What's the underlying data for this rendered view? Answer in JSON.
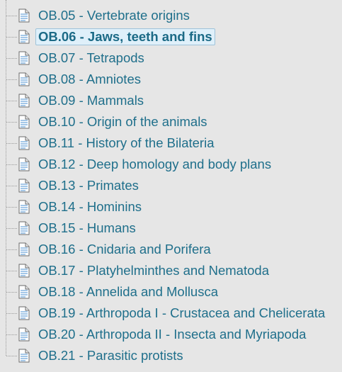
{
  "tree": {
    "items": [
      {
        "label": "OB.05 - Vertebrate origins",
        "selected": false
      },
      {
        "label": "OB.06 - Jaws, teeth and fins",
        "selected": true
      },
      {
        "label": "OB.07 - Tetrapods",
        "selected": false
      },
      {
        "label": "OB.08 - Amniotes",
        "selected": false
      },
      {
        "label": "OB.09 - Mammals",
        "selected": false
      },
      {
        "label": "OB.10 - Origin of the animals",
        "selected": false
      },
      {
        "label": "OB.11 - History of the Bilateria",
        "selected": false
      },
      {
        "label": "OB.12 - Deep homology and body plans",
        "selected": false
      },
      {
        "label": "OB.13 - Primates",
        "selected": false
      },
      {
        "label": "OB.14 - Hominins",
        "selected": false
      },
      {
        "label": "OB.15 - Humans",
        "selected": false
      },
      {
        "label": "OB.16 - Cnidaria and Porifera",
        "selected": false
      },
      {
        "label": "OB.17 - Platyhelminthes and Nematoda",
        "selected": false
      },
      {
        "label": "OB.18 - Annelida and Mollusca",
        "selected": false
      },
      {
        "label": "OB.19 - Arthropoda I - Crustacea and Chelicerata",
        "selected": false
      },
      {
        "label": "OB.20 - Arthropoda II - Insecta and Myriapoda",
        "selected": false
      },
      {
        "label": "OB.21 - Parasitic protists",
        "selected": false
      }
    ],
    "icon": "document-icon"
  },
  "colors": {
    "background": "#e6e6e6",
    "link": "#1f6f8b",
    "selected_bg": "#dff0fa",
    "selected_border": "#9fc3da"
  }
}
